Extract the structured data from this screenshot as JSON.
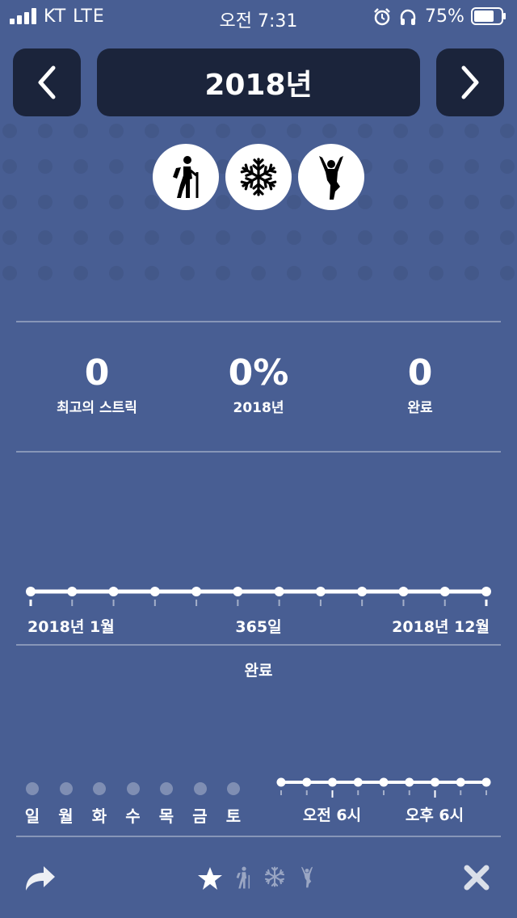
{
  "status": {
    "carrier": "KT  LTE",
    "time": "오전 7:31",
    "battery": "75%",
    "battery_level": 0.75
  },
  "header": {
    "title": "2018년",
    "prev_icon": "chevron-left-icon",
    "next_icon": "chevron-right-icon"
  },
  "habit_icons": [
    "hiking-icon",
    "snowflake-icon",
    "yoga-icon"
  ],
  "stats": [
    {
      "value": "0",
      "label": "최고의 스트릭"
    },
    {
      "value": "0%",
      "label": "2018년"
    },
    {
      "value": "0",
      "label": "완료"
    }
  ],
  "timeline": {
    "start_label": "2018년 1월",
    "center_label": "365일",
    "end_label": "2018년 12월",
    "caption": "완료",
    "month_count": 12
  },
  "weekdays": [
    "일",
    "월",
    "화",
    "수",
    "목",
    "금",
    "토"
  ],
  "day_timeline": {
    "labels": [
      "오전 6시",
      "오후 6시"
    ],
    "point_count": 9
  },
  "bottom_bar": {
    "share_icon": "share-icon",
    "filter_icons": [
      "star-icon",
      "hiking-icon",
      "snowflake-icon",
      "yoga-icon"
    ],
    "close_icon": "close-icon"
  },
  "colors": {
    "background": "#485e93",
    "header_button": "#1b243b",
    "accent": "#ffffff"
  }
}
